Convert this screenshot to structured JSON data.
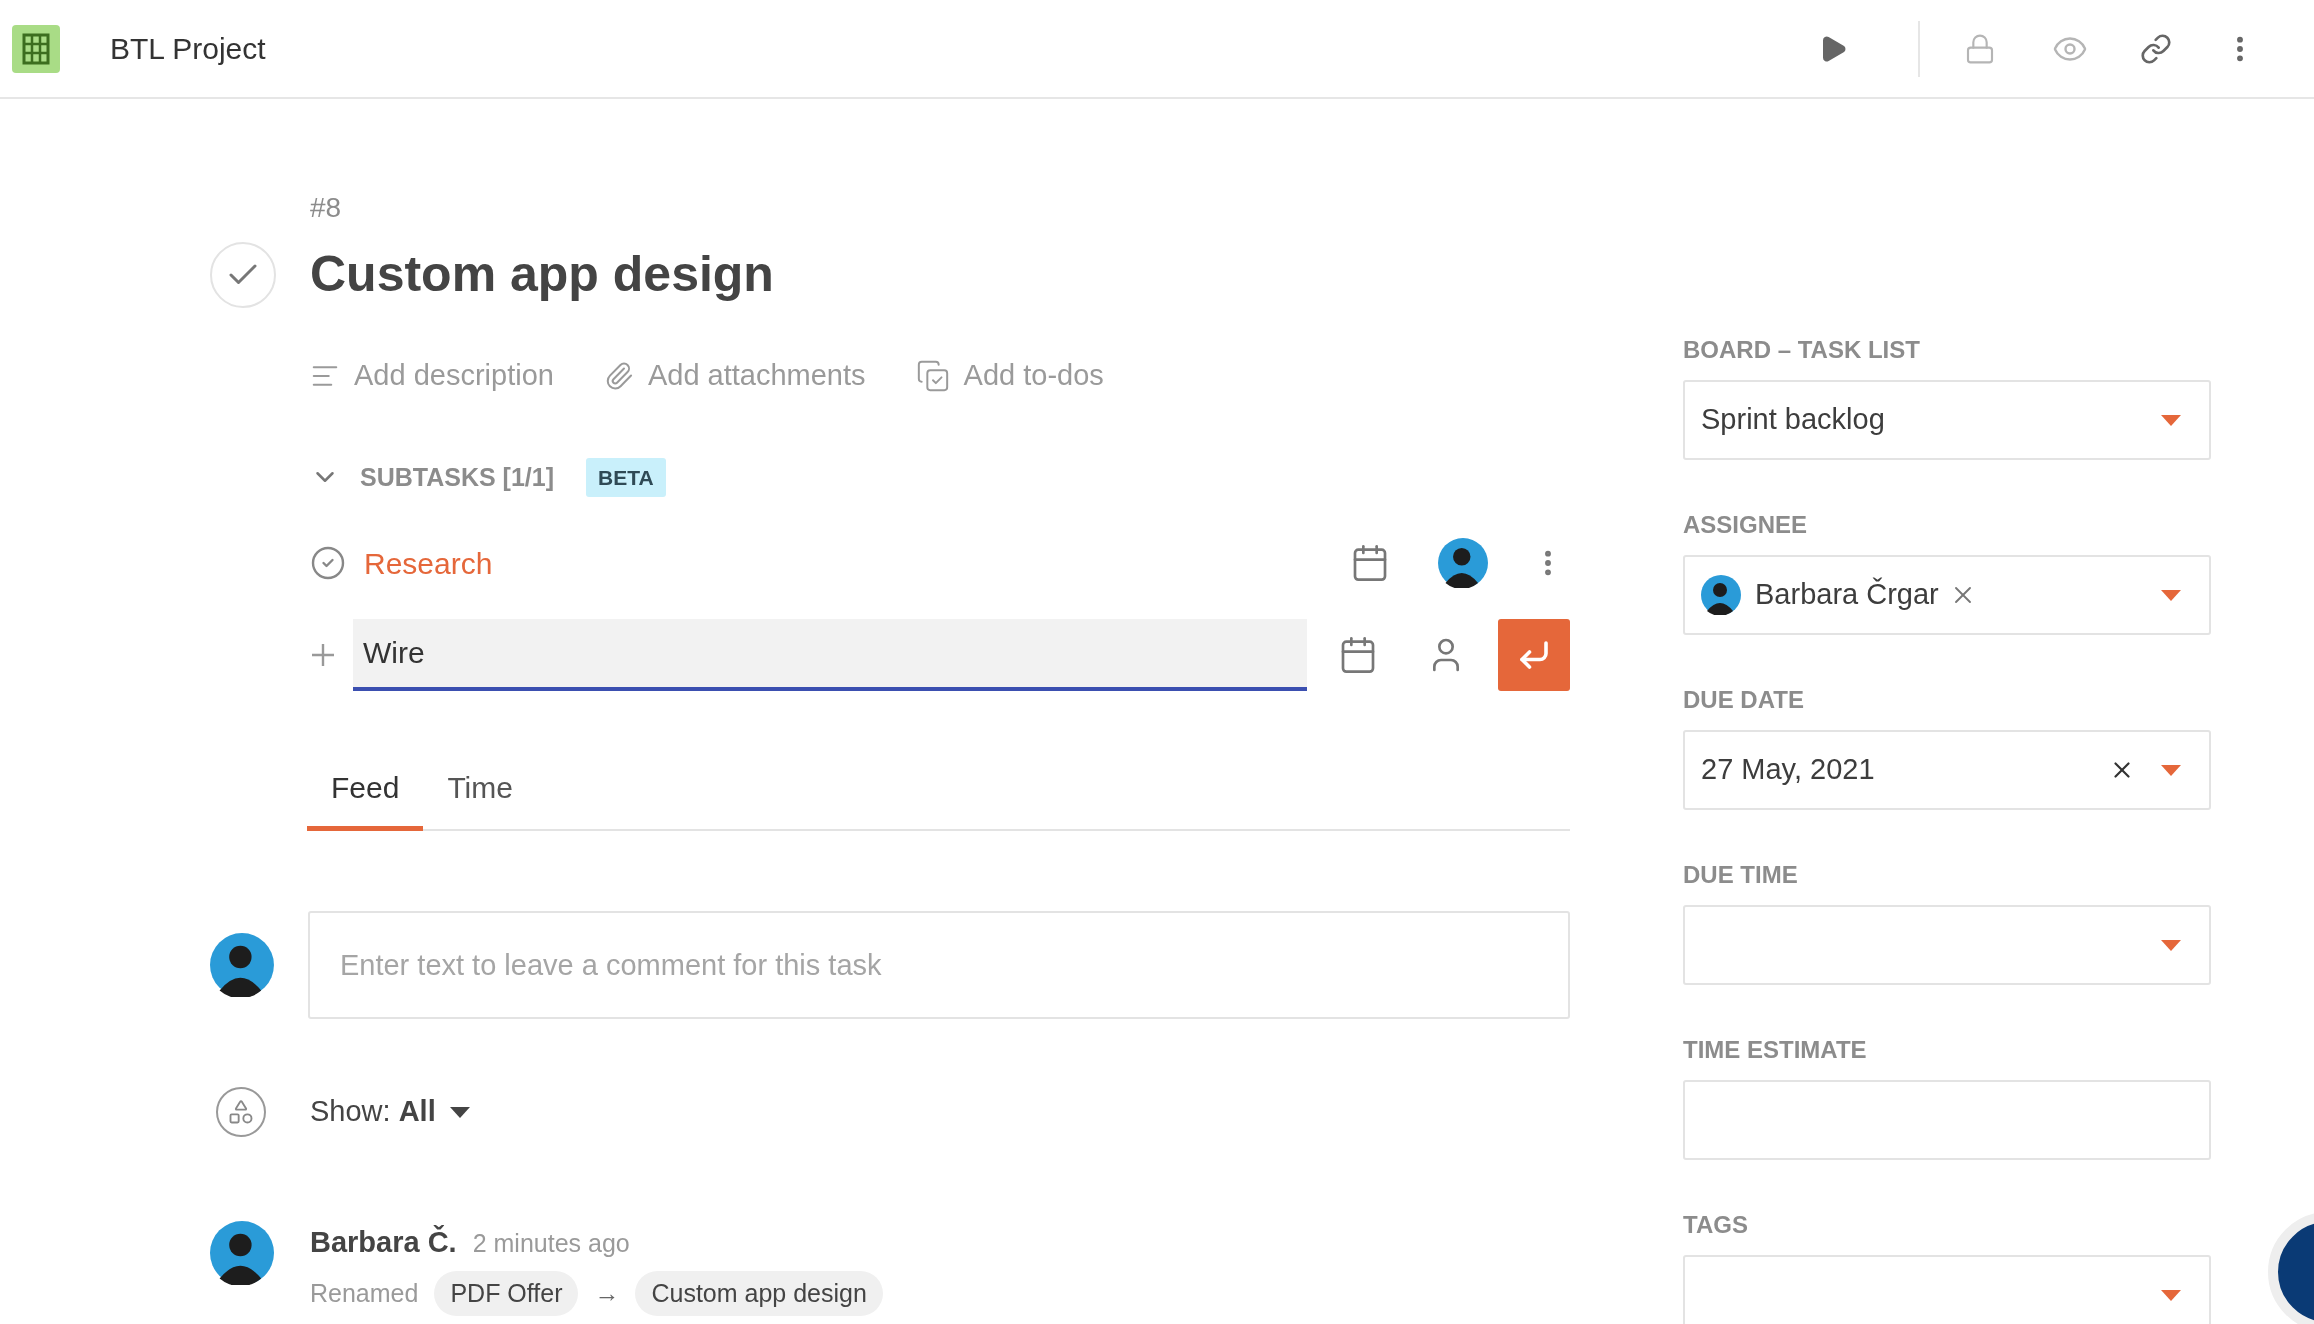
{
  "app": {
    "title": "BTL Project"
  },
  "task": {
    "number": "#8",
    "title": "Custom app design"
  },
  "actions": [
    {
      "kind": "description",
      "label": "Add description"
    },
    {
      "kind": "attachments",
      "label": "Add attachments"
    },
    {
      "kind": "todos",
      "label": "Add to-dos"
    }
  ],
  "subtasks": {
    "label": "SUBTASKS [1/1]",
    "expanded": true,
    "badge": "BETA",
    "items": [
      {
        "name": "Research",
        "done": true
      }
    ],
    "new_subtask": {
      "value": "Wire"
    }
  },
  "tabs": [
    {
      "label": "Feed",
      "selected": true
    },
    {
      "label": "Time",
      "selected": false
    }
  ],
  "comment": {
    "placeholder": "Enter text to leave a comment for this task"
  },
  "filter": {
    "label": "Show:",
    "value": "All"
  },
  "activity": [
    {
      "author": "Barbara Č.",
      "time": "2 minutes ago",
      "action": "Renamed",
      "from": "PDF Offer",
      "separator": "→",
      "to": "Custom app design"
    }
  ],
  "sidebar": {
    "fields": [
      {
        "label": "BOARD – TASK LIST",
        "kind": "select",
        "value": "Sprint backlog",
        "clearable": false
      },
      {
        "label": "ASSIGNEE",
        "kind": "person",
        "value": "Barbara Črgar",
        "clearable": true
      },
      {
        "label": "DUE DATE",
        "kind": "select",
        "value": "27 May, 2021",
        "clearable": true
      },
      {
        "label": "DUE TIME",
        "kind": "select",
        "clearable": false
      },
      {
        "label": "TIME ESTIMATE",
        "kind": "text",
        "clearable": false
      },
      {
        "label": "TAGS",
        "kind": "select",
        "clearable": false
      }
    ]
  }
}
